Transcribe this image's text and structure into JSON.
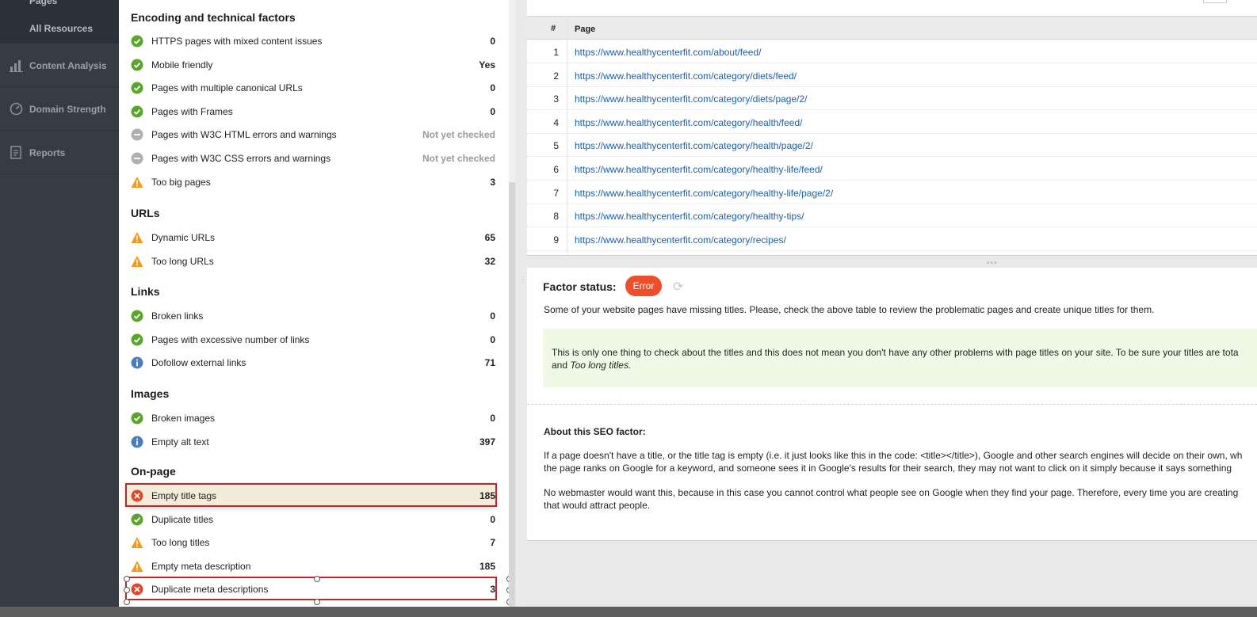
{
  "sidebar": {
    "sub_items": [
      "Pages",
      "All Resources"
    ],
    "items": [
      {
        "label": "Content Analysis",
        "icon": "chart-icon"
      },
      {
        "label": "Domain Strength",
        "icon": "gauge-icon"
      },
      {
        "label": "Reports",
        "icon": "report-icon"
      }
    ]
  },
  "factors": {
    "sections": [
      {
        "title": "Encoding and technical factors",
        "rows": [
          {
            "name": "HTTPS pages with mixed content issues",
            "value": "0",
            "status": "ok"
          },
          {
            "name": "Mobile friendly",
            "value": "Yes",
            "status": "ok"
          },
          {
            "name": "Pages with multiple canonical URLs",
            "value": "0",
            "status": "ok"
          },
          {
            "name": "Pages with Frames",
            "value": "0",
            "status": "ok"
          },
          {
            "name": "Pages with W3C HTML errors and warnings",
            "value": "Not yet checked",
            "status": "unchecked"
          },
          {
            "name": "Pages with W3C CSS errors and warnings",
            "value": "Not yet checked",
            "status": "unchecked"
          },
          {
            "name": "Too big pages",
            "value": "3",
            "status": "warning"
          }
        ]
      },
      {
        "title": "URLs",
        "rows": [
          {
            "name": "Dynamic URLs",
            "value": "65",
            "status": "warning"
          },
          {
            "name": "Too long URLs",
            "value": "32",
            "status": "warning"
          }
        ]
      },
      {
        "title": "Links",
        "rows": [
          {
            "name": "Broken links",
            "value": "0",
            "status": "ok"
          },
          {
            "name": "Pages with excessive number of links",
            "value": "0",
            "status": "ok"
          },
          {
            "name": "Dofollow external links",
            "value": "71",
            "status": "info"
          }
        ]
      },
      {
        "title": "Images",
        "rows": [
          {
            "name": "Broken images",
            "value": "0",
            "status": "ok"
          },
          {
            "name": "Empty alt text",
            "value": "397",
            "status": "info"
          }
        ]
      },
      {
        "title": "On-page",
        "rows": [
          {
            "name": "Empty title tags",
            "value": "185",
            "status": "error"
          },
          {
            "name": "Duplicate titles",
            "value": "0",
            "status": "ok"
          },
          {
            "name": "Too long titles",
            "value": "7",
            "status": "warning"
          },
          {
            "name": "Empty meta description",
            "value": "185",
            "status": "warning"
          },
          {
            "name": "Duplicate meta descriptions",
            "value": "3",
            "status": "error"
          }
        ]
      }
    ]
  },
  "table": {
    "col_num": "#",
    "col_page": "Page",
    "rows": [
      {
        "n": "1",
        "url": "https://www.healthycenterfit.com/about/feed/"
      },
      {
        "n": "2",
        "url": "https://www.healthycenterfit.com/category/diets/feed/"
      },
      {
        "n": "3",
        "url": "https://www.healthycenterfit.com/category/diets/page/2/"
      },
      {
        "n": "4",
        "url": "https://www.healthycenterfit.com/category/health/feed/"
      },
      {
        "n": "5",
        "url": "https://www.healthycenterfit.com/category/health/page/2/"
      },
      {
        "n": "6",
        "url": "https://www.healthycenterfit.com/category/healthy-life/feed/"
      },
      {
        "n": "7",
        "url": "https://www.healthycenterfit.com/category/healthy-life/page/2/"
      },
      {
        "n": "8",
        "url": "https://www.healthycenterfit.com/category/healthy-tips/"
      },
      {
        "n": "9",
        "url": "https://www.healthycenterfit.com/category/recipes/"
      }
    ]
  },
  "details": {
    "factor_status_label": "Factor status:",
    "badge": "Error",
    "description": "Some of your website pages have missing titles. Please, check the above table to review the problematic pages and create unique titles for them.",
    "note_line1": "This is only one thing to check about the titles and this does not mean you don't have any other problems with page titles on your site. To be sure your titles are tota",
    "note_and": "and ",
    "note_italic": "Too long titles.",
    "about_heading": "About this SEO factor:",
    "about_p1_l1": "If a page doesn't have a title, or the title tag is empty (i.e. it just looks like this in the code: <title></title>), Google and other search engines will decide on their own, wh",
    "about_p1_l2": "the page ranks on Google for a keyword, and someone sees it in Google's results for their search, they may not want to click on it simply because it says something",
    "about_p2_l1": "No webmaster would want this, because in this case you cannot control what people see on Google when they find your page. Therefore, every time you are creating",
    "about_p2_l2": "that would attract people."
  },
  "colors": {
    "ok": "#5aa52b",
    "warning": "#f39a1e",
    "error": "#e0482b",
    "info": "#4a7ec0",
    "unchecked": "#b0b0b0",
    "link": "#1d5ea8"
  }
}
